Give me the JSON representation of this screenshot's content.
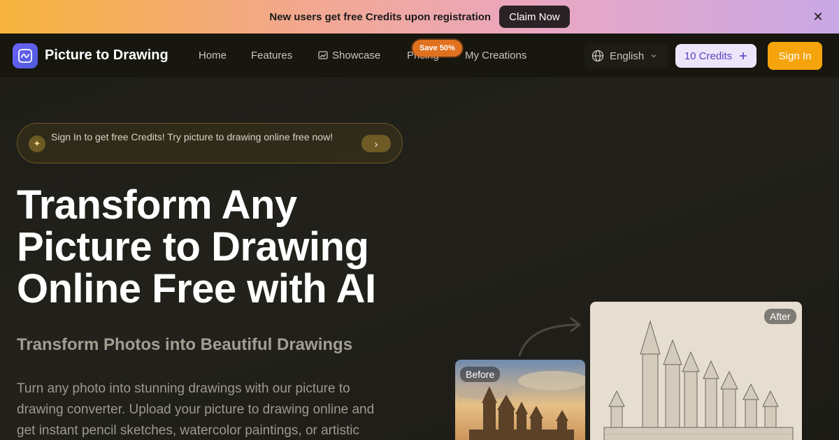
{
  "promo": {
    "text": "New users get free Credits upon registration",
    "button": "Claim Now",
    "close": "✕"
  },
  "nav": {
    "brand": "Picture to Drawing",
    "links": [
      "Home",
      "Features",
      "Showcase",
      "Pricing",
      "My Creations"
    ],
    "save_badge": "Save 50%",
    "language": "English",
    "credits": "10 Credits",
    "signin": "Sign In"
  },
  "hero": {
    "notice": "Sign In to get free Credits! Try picture to drawing online free now!",
    "headline": "Transform Any Picture to Drawing Online Free with AI",
    "subhead": "Transform Photos into Beautiful Drawings",
    "body": "Turn any photo into stunning drawings with our picture to drawing converter. Upload your picture to drawing online and get instant pencil sketches, watercolor paintings, or artistic",
    "before_label": "Before",
    "after_label": "After"
  },
  "colors": {
    "accent": "#f5a40c",
    "credits_bg": "#ece6fb",
    "credits_text": "#5b3fc2",
    "save_badge": "#e0711f"
  },
  "icons": [
    "close-icon",
    "logo-icon",
    "showcase-icon",
    "globe-icon",
    "chevron-down-icon",
    "plus-icon",
    "sparkle-icon",
    "chevron-right-icon",
    "curved-arrow-icon"
  ]
}
